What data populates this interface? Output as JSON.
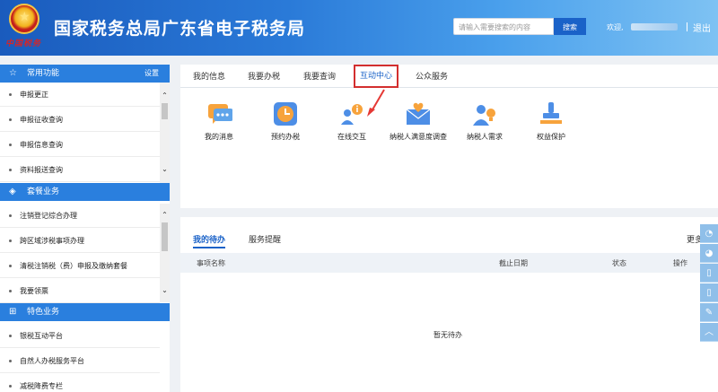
{
  "header": {
    "emblem_caption": "中国税务",
    "site_title": "国家税务总局广东省电子税务局",
    "search_placeholder": "请输入需要搜索的内容",
    "search_button": "搜索",
    "welcome": "欢迎,",
    "logout": "退出"
  },
  "sidebar": {
    "sections": [
      {
        "title": "常用功能",
        "icon": "star-icon",
        "settings": "设置",
        "items": [
          "申报更正",
          "申报征收查询",
          "申报信息查询",
          "资料报送查询"
        ]
      },
      {
        "title": "套餐业务",
        "icon": "layers-icon",
        "items": [
          "注销登记综合办理",
          "跨区域涉税事项办理",
          "清税注销税（费）申报及缴纳套餐",
          "我要领票"
        ]
      },
      {
        "title": "特色业务",
        "icon": "grid-icon",
        "items": [
          "银税互动平台",
          "自然人办税服务平台",
          "减税降费专栏"
        ]
      }
    ]
  },
  "tabs": [
    {
      "label": "我的信息"
    },
    {
      "label": "我要办税"
    },
    {
      "label": "我要查询"
    },
    {
      "label": "互动中心",
      "active": true
    },
    {
      "label": "公众服务"
    }
  ],
  "features": [
    {
      "label": "我的消息",
      "icon": "message-bubble-icon"
    },
    {
      "label": "预约办税",
      "icon": "clock-icon"
    },
    {
      "label": "在线交互",
      "icon": "user-info-icon"
    },
    {
      "label": "纳税人满意度调查",
      "icon": "envelope-heart-icon"
    },
    {
      "label": "纳税人需求",
      "icon": "user-bulb-icon"
    },
    {
      "label": "权益保护",
      "icon": "stamp-icon"
    }
  ],
  "todo": {
    "tabs": [
      "我的待办",
      "服务提醒"
    ],
    "more": "更多",
    "columns": [
      "事项名称",
      "截止日期",
      "状态",
      "操作"
    ],
    "empty_text": "暂无待办"
  },
  "floating_toolbar": [
    "weibo-icon",
    "weibo-icon",
    "mobile-icon",
    "mobile-icon",
    "edit-icon",
    "chevron-up-icon"
  ],
  "colors": {
    "header_gradient_start": "#1a5bbd",
    "section_blue": "#2a7fde",
    "active_tab_border": "#d32f2f",
    "active_text": "#1a62c8"
  }
}
